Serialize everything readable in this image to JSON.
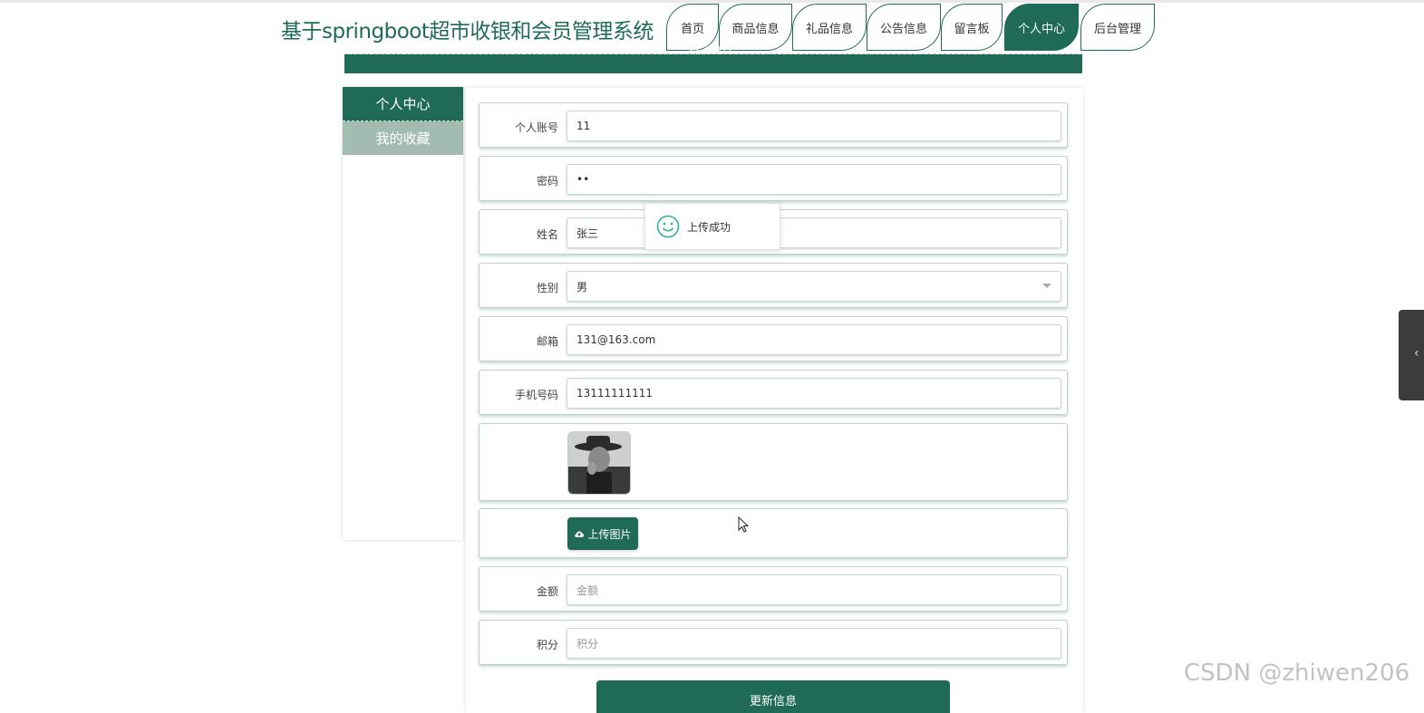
{
  "site": {
    "title": "基于springboot超市收银和会员管理系统"
  },
  "nav": {
    "tabs": [
      {
        "label": "首页"
      },
      {
        "label": "商品信息"
      },
      {
        "label": "礼品信息"
      },
      {
        "label": "公告信息"
      },
      {
        "label": "留言板"
      },
      {
        "label": "个人中心",
        "active": true
      },
      {
        "label": "后台管理"
      }
    ]
  },
  "banner": {
    "title": "个人中心"
  },
  "sidebar": {
    "items": [
      {
        "label": "个人中心",
        "active": true
      },
      {
        "label": "我的收藏"
      }
    ]
  },
  "form": {
    "account": {
      "label": "个人账号",
      "value": "11"
    },
    "password": {
      "label": "密码",
      "value": "••"
    },
    "name": {
      "label": "姓名",
      "value": "张三"
    },
    "gender": {
      "label": "性别",
      "value": "男"
    },
    "email": {
      "label": "邮箱",
      "value": "131@163.com"
    },
    "phone": {
      "label": "手机号码",
      "value": "13111111111"
    },
    "upload_label": "上传图片",
    "amount": {
      "label": "金额",
      "placeholder": "金额"
    },
    "points": {
      "label": "积分",
      "placeholder": "积分"
    },
    "submit_label": "更新信息"
  },
  "toast": {
    "message": "上传成功"
  },
  "watermark": "CSDN @zhiwen206",
  "colors": {
    "primary": "#1f6b57",
    "sidebar_inactive": "#a3bcb1"
  }
}
